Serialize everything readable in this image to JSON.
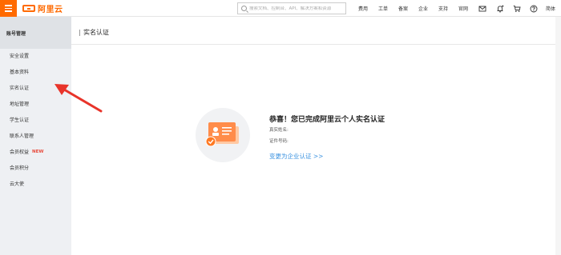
{
  "header": {
    "logo_text": "阿里云",
    "search_placeholder": "搜索文档、控制台、API、解决方案和资源",
    "nav": [
      "费用",
      "工单",
      "备案",
      "企业",
      "支持",
      "官网"
    ],
    "icons": [
      "mail-icon",
      "bell-icon",
      "cart-icon",
      "help-icon"
    ],
    "lang": "简体"
  },
  "sidebar": {
    "title": "账号管理",
    "items": [
      {
        "label": "安全设置"
      },
      {
        "label": "基本资料"
      },
      {
        "label": "实名认证"
      },
      {
        "label": "地址管理"
      },
      {
        "label": "学生认证"
      },
      {
        "label": "联系人管理"
      },
      {
        "label": "会员权益",
        "badge": "NEW"
      },
      {
        "label": "会员积分"
      },
      {
        "label": "云大使"
      }
    ]
  },
  "main": {
    "title": "实名认证",
    "success_title": "恭喜！您已完成阿里云个人实名认证",
    "real_name_label": "真实姓名:",
    "id_label": "证件号码:",
    "change_link": "变更为企业认证 >>"
  },
  "colors": {
    "brand": "#ff6a00",
    "link": "#3a92e0",
    "new_badge": "#e84a3b",
    "annotation_arrow": "#e8342a"
  }
}
